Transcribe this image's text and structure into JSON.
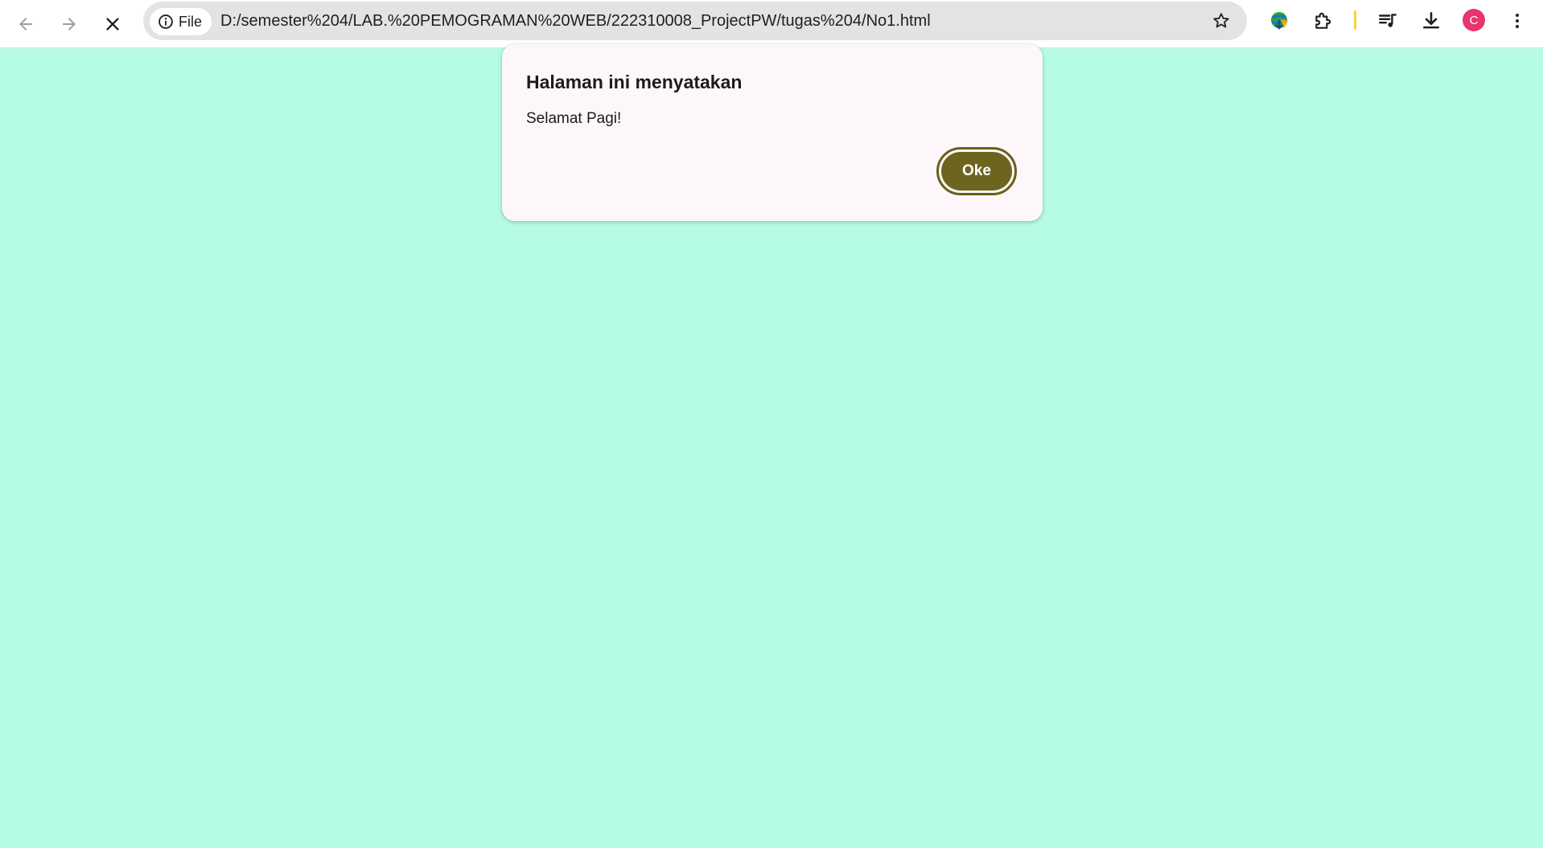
{
  "browser": {
    "site_info_label": "File",
    "url": "D:/semester%204/LAB.%20PEMOGRAMAN%20WEB/222310008_ProjectPW/tugas%204/No1.html",
    "profile_initial": "C",
    "icons": {
      "back": "arrow-left-icon",
      "forward": "arrow-right-icon",
      "stop": "close-icon",
      "site_info": "info-circle-icon",
      "bookmark": "star-icon",
      "downloader_extension": "globe-download-icon",
      "extensions": "puzzle-icon",
      "media": "playlist-music-icon",
      "downloads": "download-icon",
      "menu": "kebab-menu-icon"
    },
    "colors": {
      "profile_avatar": "#e8356d",
      "separator": "#f5d442"
    }
  },
  "dialog": {
    "title": "Halaman ini menyatakan",
    "message": "Selamat Pagi!",
    "ok_label": "Oke",
    "colors": {
      "button": "#6d6420",
      "background": "#fdf7fb"
    }
  },
  "page": {
    "background_color": "#b6fce4"
  }
}
